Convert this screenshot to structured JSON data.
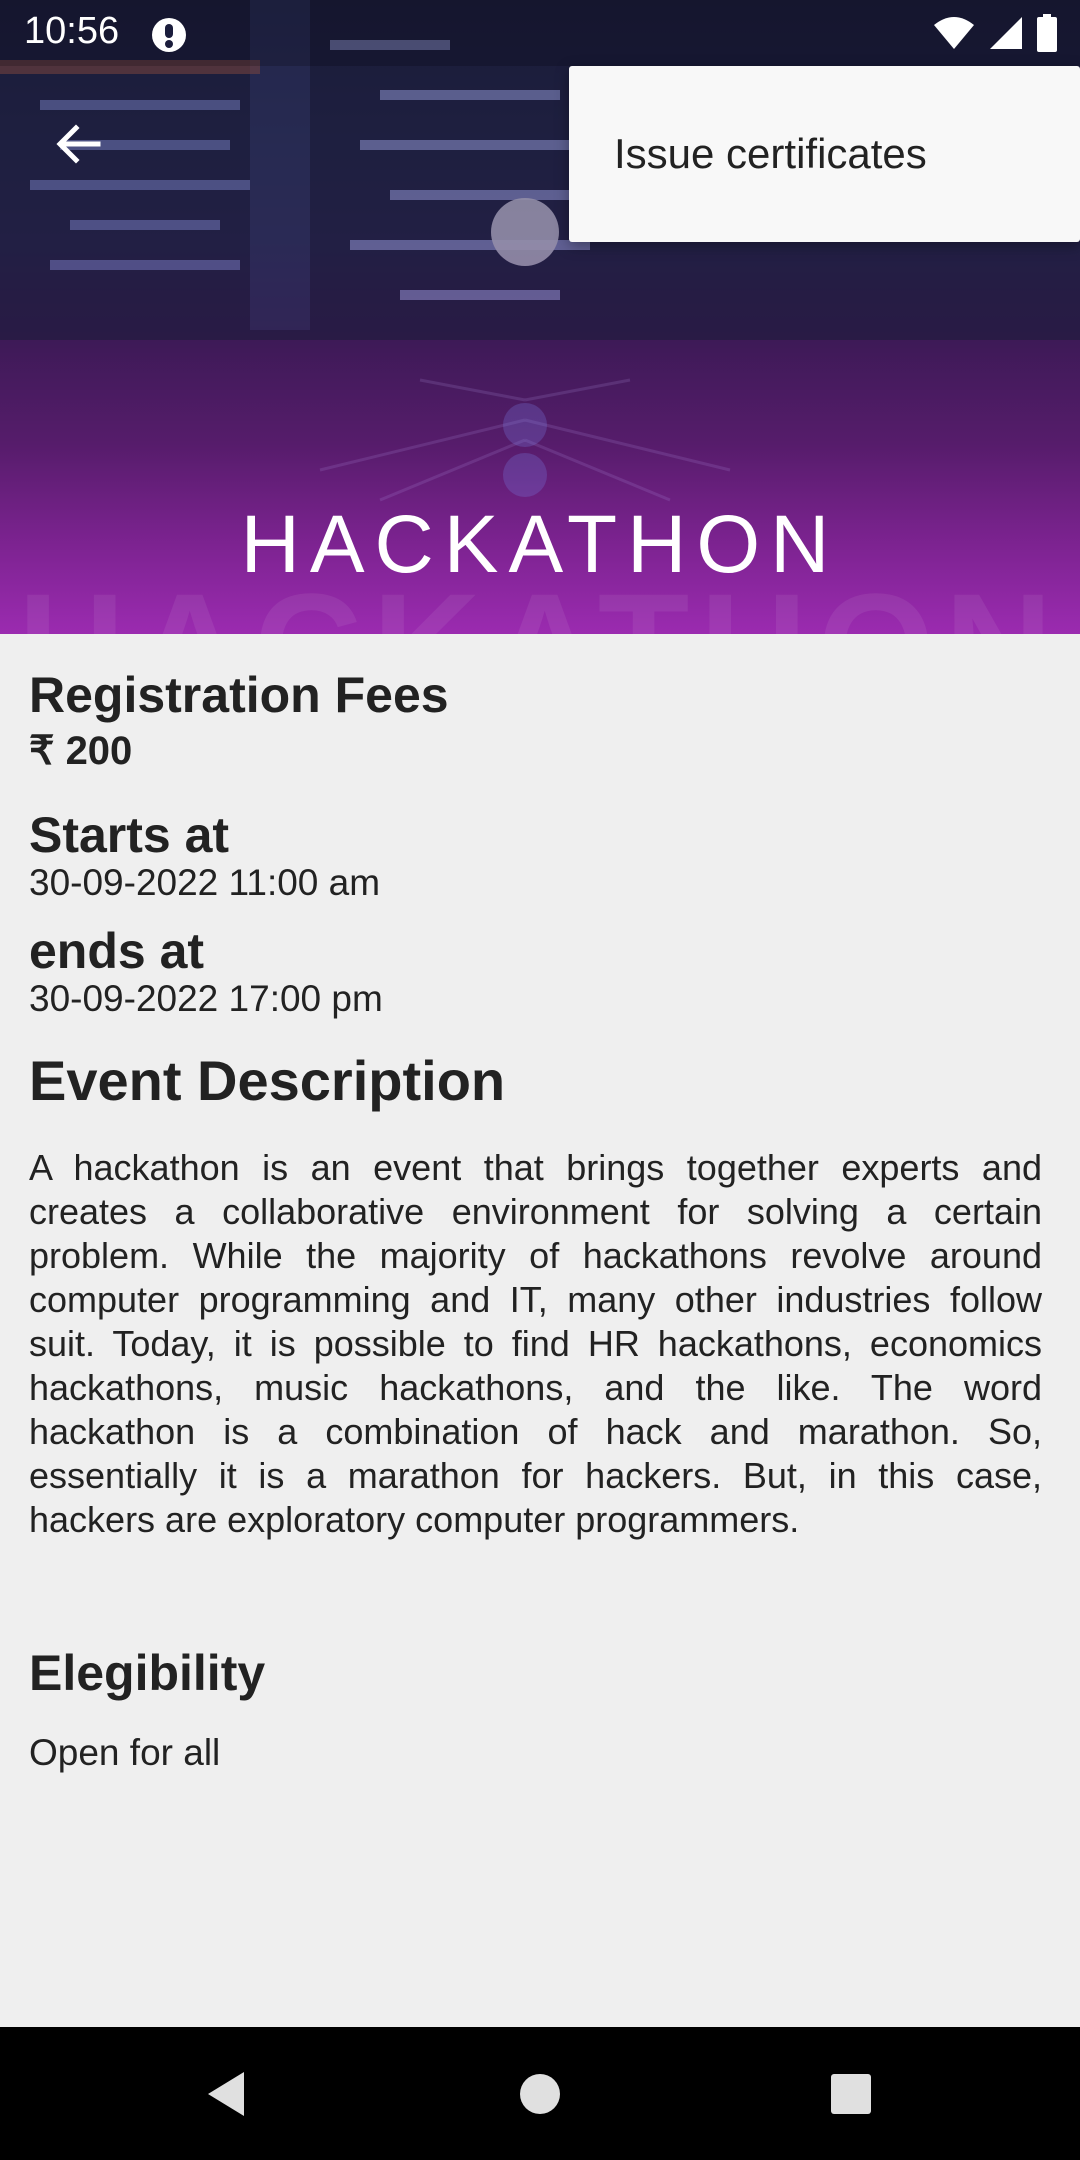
{
  "status_bar": {
    "time": "10:56",
    "icons": [
      "app-notification-icon",
      "wifi-icon",
      "signal-icon",
      "battery-icon"
    ]
  },
  "toolbar": {
    "back_icon": "arrow-back-icon"
  },
  "popup_menu": {
    "items": [
      {
        "label": "Issue certificates"
      }
    ]
  },
  "hero": {
    "title": "HACKATHON",
    "watermark": "HACKATHON"
  },
  "registration": {
    "heading": "Registration Fees",
    "value": "₹ 200"
  },
  "schedule": {
    "starts_label": "Starts at",
    "starts_value": "30-09-2022 11:00 am",
    "ends_label": "ends at",
    "ends_value": "30-09-2022 17:00 pm"
  },
  "description": {
    "heading": "Event Description",
    "text": "A hackathon is an event that brings together experts and creates a collaborative environment for solving a certain problem. While the majority of hackathons revolve around computer programming and IT, many other industries follow suit. Today, it is possible to find HR hackathons, economics hackathons, music hackathons, and the like. The word hackathon is a combination of hack and marathon. So, essentially it is a marathon for hackers.  But, in this case, hackers are exploratory computer programmers."
  },
  "eligibility": {
    "heading": "Elegibility",
    "value": "Open for all"
  },
  "nav_bar": {
    "buttons": [
      "back-triangle-icon",
      "home-circle-icon",
      "recents-square-icon"
    ]
  },
  "colors": {
    "hero_top": "#1b1d3c",
    "hero_bottom": "#9b2bb0",
    "background": "#efefef",
    "text": "#222222",
    "menu_bg": "#f8f8f8"
  }
}
